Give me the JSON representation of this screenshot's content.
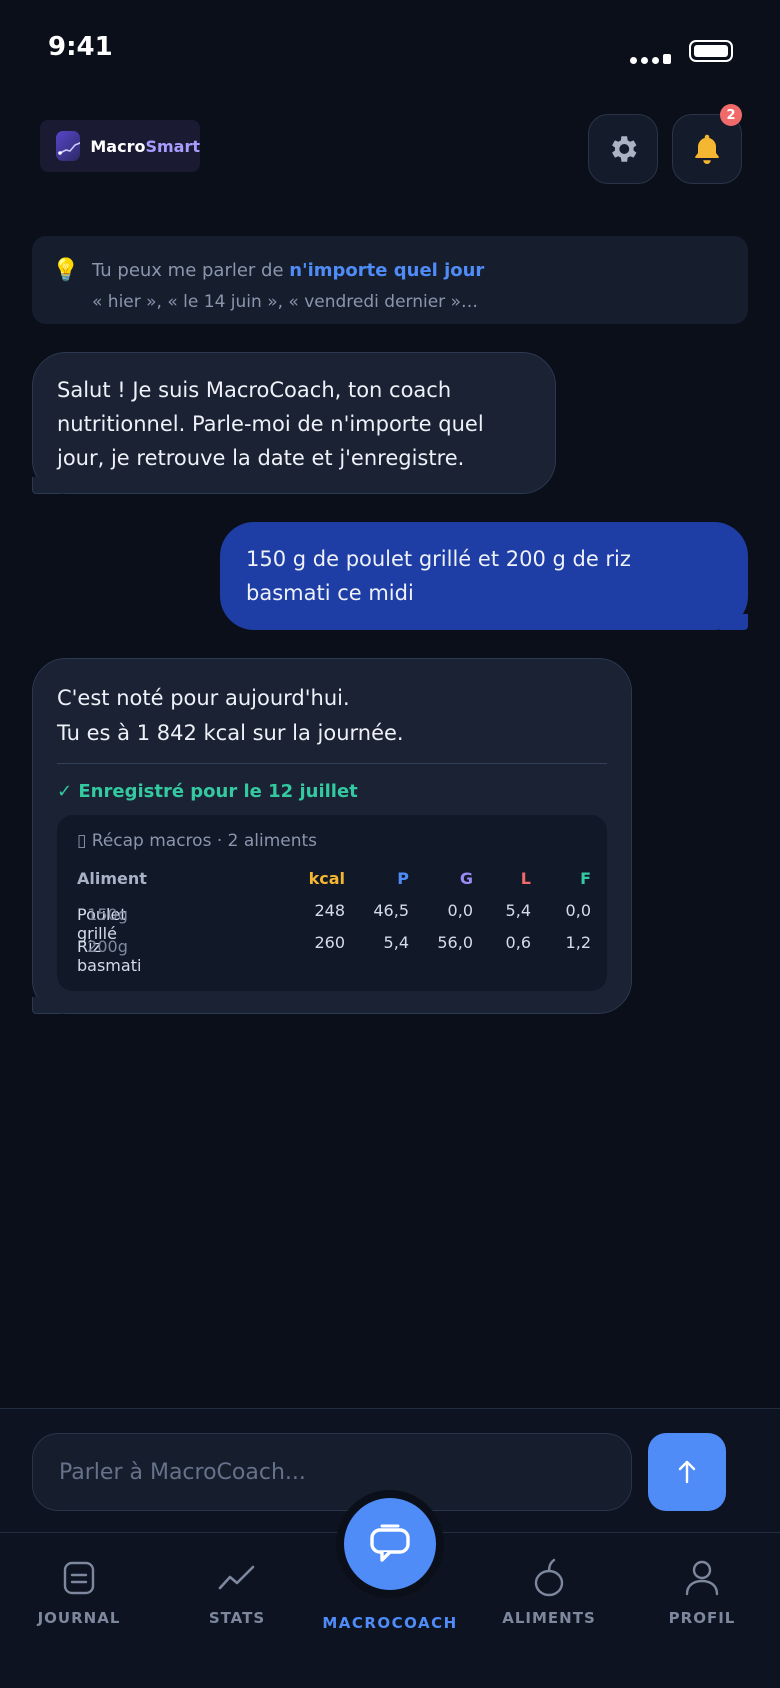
{
  "status_bar": {
    "time": "9:41"
  },
  "header": {
    "brand_part1": "Macro",
    "brand_part2": "Smart",
    "settings_icon": "gear-icon",
    "notifications_icon": "bell-icon",
    "notification_count": "2"
  },
  "tip": {
    "icon": "lightbulb-icon",
    "prefix": "Tu peux me parler de ",
    "highlight": "n'importe quel jour",
    "examples": "« hier », « le 14 juin », « vendredi dernier »…"
  },
  "messages": {
    "m1": {
      "sender": "bot",
      "text": "Salut ! Je suis MacroCoach, ton coach nutritionnel. Parle-moi de n'importe quel jour, je retrouve la date et j'enregistre."
    },
    "m2": {
      "sender": "user",
      "text": "150 g de poulet grillé et 200 g de riz basmati ce midi"
    },
    "m3": {
      "sender": "bot",
      "line1": "C'est noté pour aujourd'hui.",
      "line2": "Tu es à 1 842 kcal sur la journée.",
      "saved_label": "Enregistré pour le 12 juillet",
      "recap": {
        "title": "Récap macros · 2 aliments",
        "headers": {
          "name": "Aliment",
          "kcal": "kcal",
          "p": "P",
          "g": "G",
          "l": "L",
          "f": "F"
        },
        "rows": [
          {
            "name": "Poulet grillé",
            "weight": "150g",
            "kcal": "248",
            "p": "46,5",
            "g": "0,0",
            "l": "5,4",
            "f": "0,0"
          },
          {
            "name": "Riz basmati",
            "weight": "200g",
            "kcal": "260",
            "p": "5,4",
            "g": "56,0",
            "l": "0,6",
            "f": "1,2"
          }
        ]
      }
    }
  },
  "composer": {
    "placeholder": "Parler à MacroCoach...",
    "send_icon": "arrow-up-icon"
  },
  "nav": {
    "journal": "JOURNAL",
    "stats": "STATS",
    "macrocoach": "MACROCOACH",
    "aliments": "ALIMENTS",
    "profil": "PROFIL",
    "active": "macrocoach"
  },
  "colors": {
    "accent": "#4f8cf7",
    "user_bubble": "#1e3ea6",
    "success": "#34c9a0",
    "kcal": "#f5b731",
    "badge": "#f06a6a"
  }
}
